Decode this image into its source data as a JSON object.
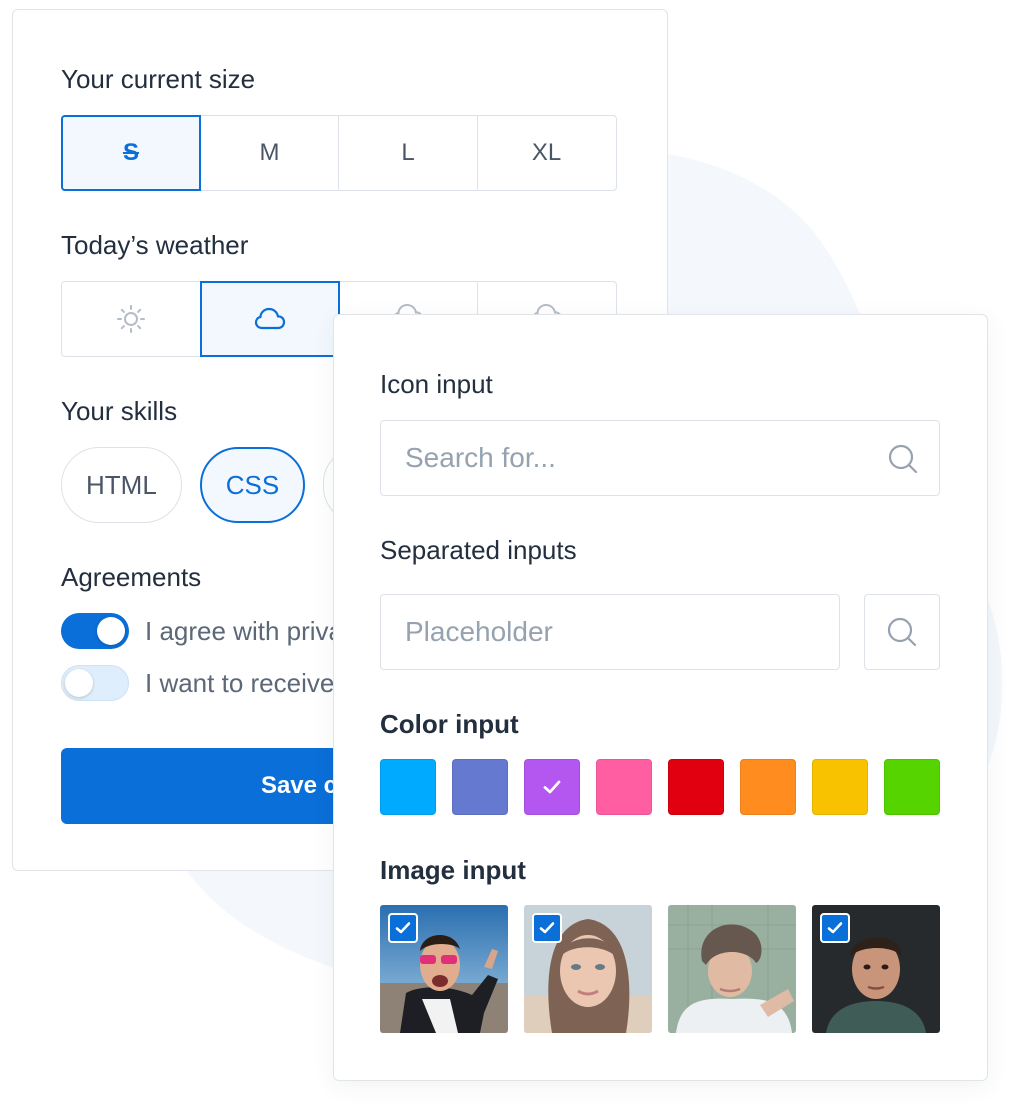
{
  "size": {
    "label": "Your current size",
    "options": [
      "S",
      "M",
      "L",
      "XL"
    ],
    "selected": "S"
  },
  "weather": {
    "label": "Today’s weather",
    "options": [
      "sun-icon",
      "cloud-icon",
      "cloud-rain-icon",
      "cloud-snow-icon"
    ],
    "selected": "cloud-icon"
  },
  "skills": {
    "label": "Your skills",
    "items": [
      "HTML",
      "CSS"
    ],
    "selected": "CSS"
  },
  "agreements": {
    "label": "Agreements",
    "items": [
      {
        "text": "I agree with privacy policy",
        "checked": true
      },
      {
        "text": "I want to receive newsletter",
        "checked": false
      }
    ]
  },
  "save": {
    "label": "Save changes"
  },
  "icon_input": {
    "label": "Icon input",
    "placeholder": "Search for..."
  },
  "separated": {
    "label": "Separated inputs",
    "placeholder": "Placeholder"
  },
  "color_input": {
    "label": "Color input",
    "colors": [
      "#00aaff",
      "#6679d1",
      "#b457f0",
      "#ff5fa2",
      "#e00010",
      "#ff8c1f",
      "#f8c200",
      "#55d400"
    ],
    "selected": "#b457f0"
  },
  "image_input": {
    "label": "Image input",
    "checked": [
      true,
      true,
      false,
      true
    ]
  },
  "theme": {
    "accent": "#0a6fd8",
    "accent_soft": "#f2f8fe",
    "border": "#dde2e8",
    "text": "#232f3e",
    "muted": "#96a2b0"
  }
}
